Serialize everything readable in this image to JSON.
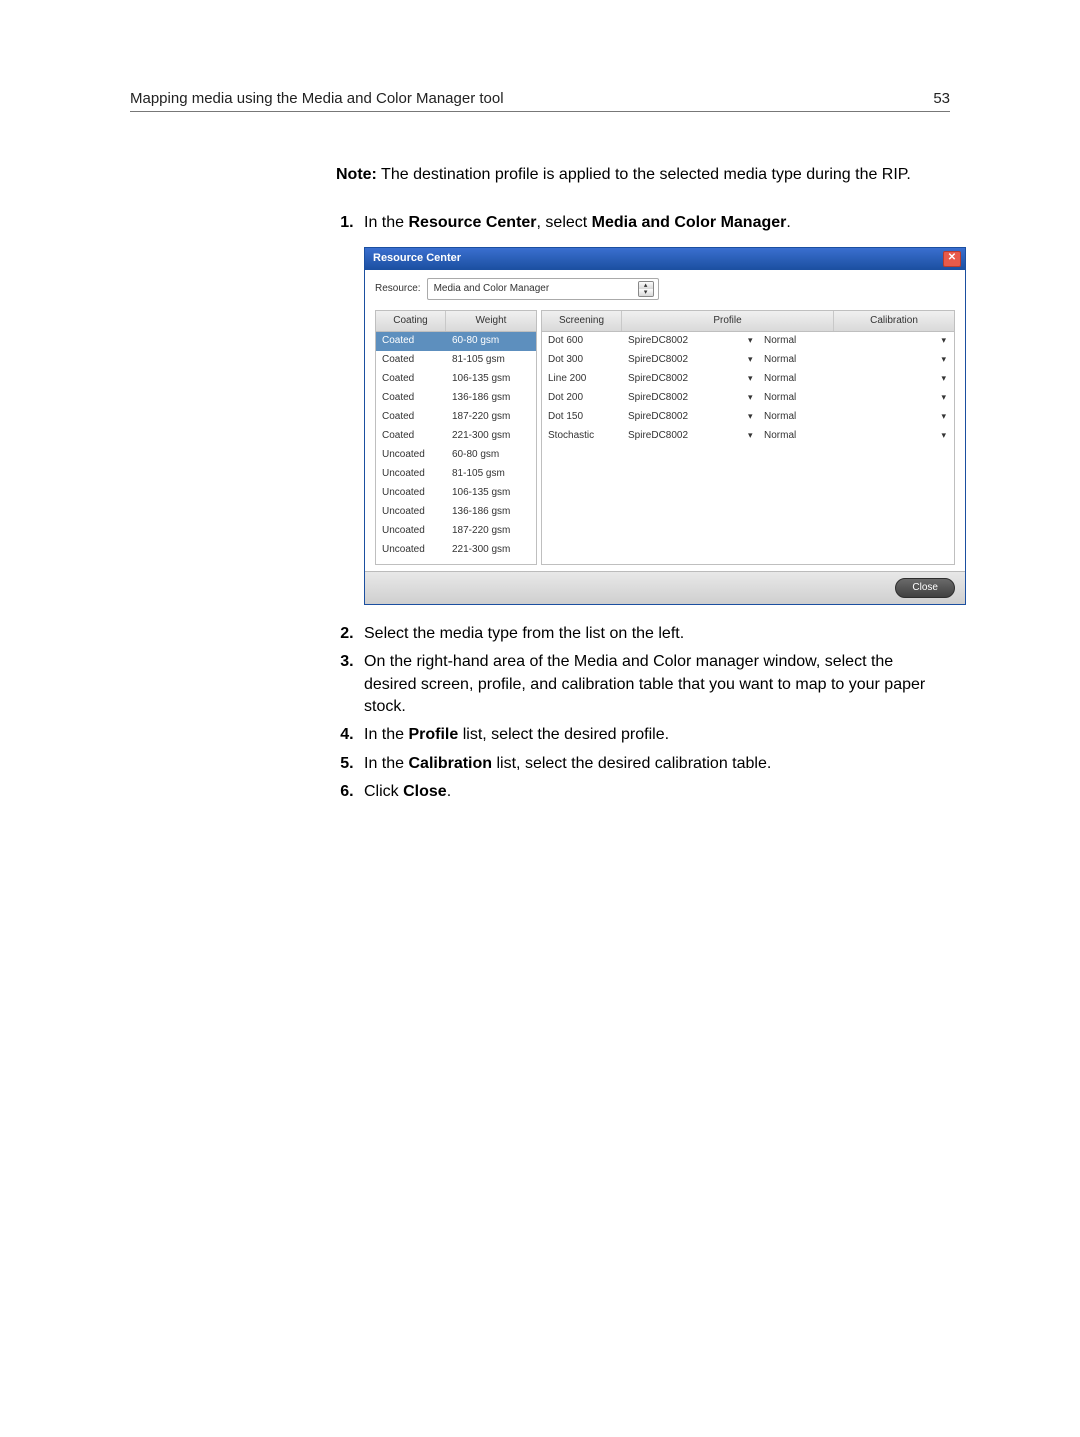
{
  "header": {
    "title": "Mapping media using the Media and Color Manager tool",
    "page_number": "53"
  },
  "note": {
    "label": "Note:",
    "text": " The destination profile is applied to the selected media type during the RIP."
  },
  "steps": {
    "s1_pre": "In the ",
    "s1_b1": "Resource Center",
    "s1_mid": ", select ",
    "s1_b2": "Media and Color Manager",
    "s1_post": ".",
    "s2": "Select the media type from the list on the left.",
    "s3": "On the right-hand area of the Media and Color manager window, select the desired screen, profile, and calibration table that you want to map to your paper stock.",
    "s4_pre": "In the ",
    "s4_b1": "Profile",
    "s4_post": " list, select the desired profile.",
    "s5_pre": "In the ",
    "s5_b1": "Calibration",
    "s5_post": " list, select the desired calibration table.",
    "s6_pre": "Click ",
    "s6_b1": "Close",
    "s6_post": "."
  },
  "rc": {
    "title": "Resource Center",
    "resource_label": "Resource:",
    "resource_value": "Media and Color Manager",
    "close_button": "Close",
    "left_headers": {
      "coating": "Coating",
      "weight": "Weight"
    },
    "right_headers": {
      "screening": "Screening",
      "profile": "Profile",
      "calibration": "Calibration"
    },
    "left_rows": [
      {
        "coating": "Coated",
        "weight": "60-80 gsm",
        "selected": true
      },
      {
        "coating": "Coated",
        "weight": "81-105 gsm"
      },
      {
        "coating": "Coated",
        "weight": "106-135 gsm"
      },
      {
        "coating": "Coated",
        "weight": "136-186 gsm"
      },
      {
        "coating": "Coated",
        "weight": "187-220 gsm"
      },
      {
        "coating": "Coated",
        "weight": "221-300 gsm"
      },
      {
        "coating": "Uncoated",
        "weight": "60-80 gsm"
      },
      {
        "coating": "Uncoated",
        "weight": "81-105 gsm"
      },
      {
        "coating": "Uncoated",
        "weight": "106-135 gsm"
      },
      {
        "coating": "Uncoated",
        "weight": "136-186 gsm"
      },
      {
        "coating": "Uncoated",
        "weight": "187-220 gsm"
      },
      {
        "coating": "Uncoated",
        "weight": "221-300 gsm"
      }
    ],
    "right_rows": [
      {
        "screening": "Dot 600",
        "profile": "SpireDC8002",
        "calibration": "Normal"
      },
      {
        "screening": "Dot 300",
        "profile": "SpireDC8002",
        "calibration": "Normal"
      },
      {
        "screening": "Line 200",
        "profile": "SpireDC8002",
        "calibration": "Normal"
      },
      {
        "screening": "Dot 200",
        "profile": "SpireDC8002",
        "calibration": "Normal"
      },
      {
        "screening": "Dot 150",
        "profile": "SpireDC8002",
        "calibration": "Normal"
      },
      {
        "screening": "Stochastic",
        "profile": "SpireDC8002",
        "calibration": "Normal"
      }
    ]
  }
}
